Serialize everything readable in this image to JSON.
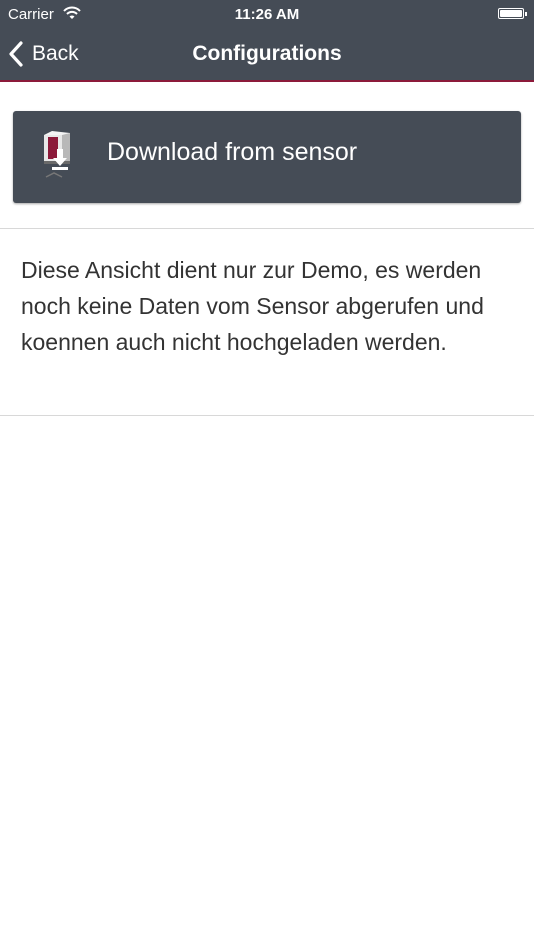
{
  "status_bar": {
    "carrier": "Carrier",
    "time": "11:26 AM"
  },
  "nav": {
    "back_label": "Back",
    "title": "Configurations"
  },
  "action_button": {
    "label": "Download from sensor",
    "icon": "sensor-download-icon"
  },
  "description": "Diese Ansicht dient nur zur Demo, es werden noch keine Daten vom Sensor abgerufen und koennen auch nicht hochgeladen werden.",
  "colors": {
    "bar_background": "#454c56",
    "accent_line": "#8c1a3a",
    "text": "#333333"
  }
}
